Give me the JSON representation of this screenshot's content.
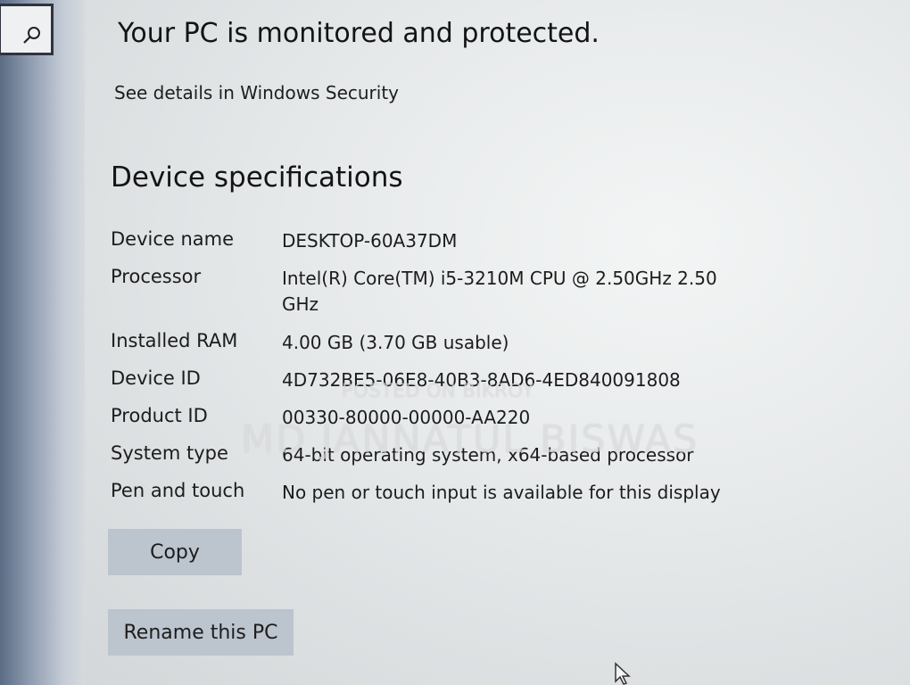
{
  "search": {
    "icon": "search-icon"
  },
  "status": {
    "title": "Your PC is monitored and protected.",
    "link": "See details in Windows Security"
  },
  "specs": {
    "title": "Device specifications",
    "rows": [
      {
        "label": "Device name",
        "value": "DESKTOP-60A37DM"
      },
      {
        "label": "Processor",
        "value": "Intel(R) Core(TM) i5-3210M CPU @ 2.50GHz   2.50 GHz"
      },
      {
        "label": "Installed RAM",
        "value": "4.00 GB (3.70 GB usable)"
      },
      {
        "label": "Device ID",
        "value": "4D732BE5-06E8-40B3-8AD6-4ED840091808"
      },
      {
        "label": "Product ID",
        "value": "00330-80000-00000-AA220"
      },
      {
        "label": "System type",
        "value": "64-bit operating system, x64-based processor"
      },
      {
        "label": "Pen and touch",
        "value": "No pen or touch input is available for this display"
      }
    ]
  },
  "buttons": {
    "copy": "Copy",
    "rename": "Rename this PC"
  },
  "watermark": {
    "line1": "POSTED ON BIKROY",
    "line2": "MD JANNATUL BISWAS"
  }
}
